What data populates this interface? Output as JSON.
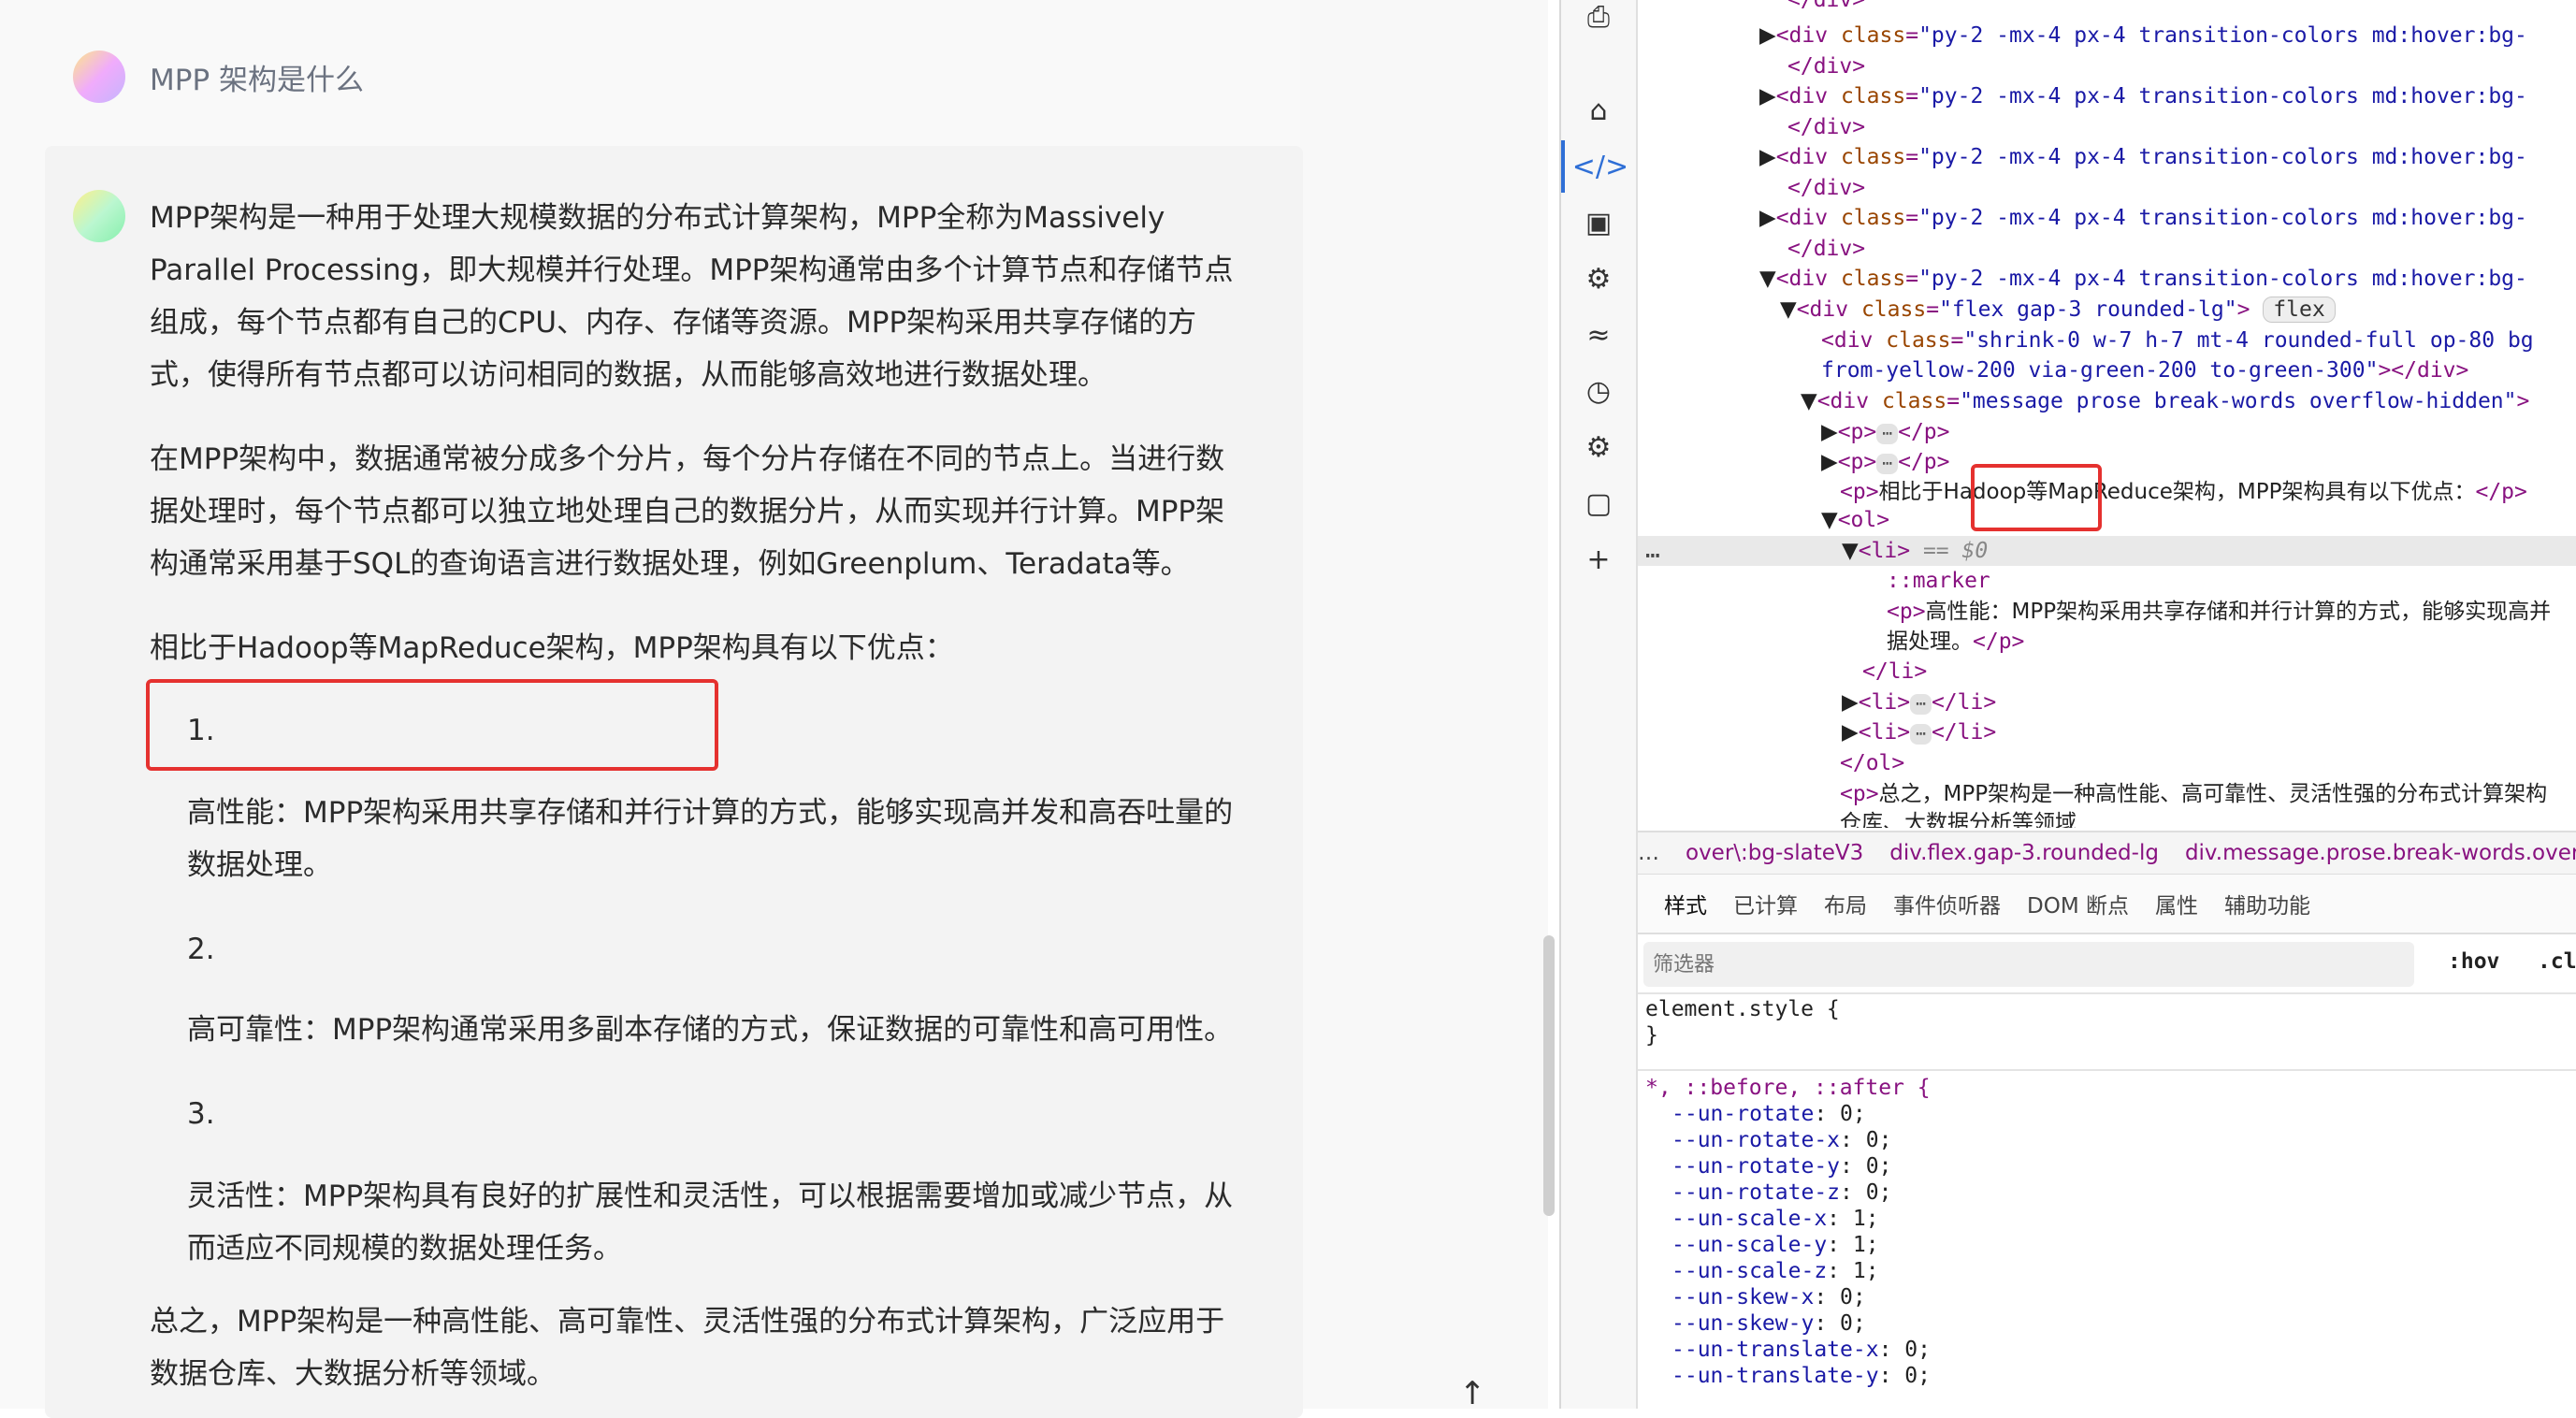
{
  "chat": {
    "user_message": "MPP 架构是什么",
    "answer": {
      "p1_lines": [
        "MPP架构是一种用于处理大规模数据的分布式计算架构，MPP全称为Massively",
        "Parallel Processing，即大规模并行处理。MPP架构通常由多个计算节点和存储节点",
        "组成，每个节点都有自己的CPU、内存、存储等资源。MPP架构采用共享存储的方",
        "式，使得所有节点都可以访问相同的数据，从而能够高效地进行数据处理。"
      ],
      "p2_lines": [
        "在MPP架构中，数据通常被分成多个分片，每个分片存储在不同的节点上。当进行数",
        "据处理时，每个节点都可以独立地处理自己的数据分片，从而实现并行计算。MPP架",
        "构通常采用基于SQL的查询语言进行数据处理，例如Greenplum、Teradata等。"
      ],
      "p3": "相比于Hadoop等MapReduce架构，MPP架构具有以下优点：",
      "list": [
        {
          "num": "1.",
          "lines": [
            "高性能：MPP架构采用共享存储和并行计算的方式，能够实现高并发和高吞吐量的",
            "数据处理。"
          ]
        },
        {
          "num": "2.",
          "lines": [
            "高可靠性：MPP架构通常采用多副本存储的方式，保证数据的可靠性和高可用性。"
          ]
        },
        {
          "num": "3.",
          "lines": [
            "灵活性：MPP架构具有良好的扩展性和灵活性，可以根据需要增加或减少节点，从",
            "而适应不同规模的数据处理任务。"
          ]
        }
      ],
      "end_lines": [
        "总之，MPP架构是一种高性能、高可靠性、灵活性强的分布式计算架构，广泛应用于",
        "数据仓库、大数据分析等领域。"
      ]
    },
    "scroll_top_icon": "↑"
  },
  "devtools": {
    "dom": {
      "close_div": "</div>",
      "div_open": "<div ",
      "class_attr": "class",
      "py_class": "\"py-2 -mx-4 px-4 transition-colors md:hover:bg-",
      "flex_class": "\"flex gap-3 rounded-lg\"",
      "flex_badge": "flex",
      "shrink_class_1": "\"shrink-0 w-7 h-7 mt-4 rounded-full op-80 bg",
      "shrink_class_2": "from-yellow-200 via-green-200 to-green-300\"",
      "message_class": "\"message prose break-words overflow-hidden\"",
      "p_open": "<p>",
      "p_close": "</p>",
      "ell": "⋯",
      "p_text": "相比于Hadoop等MapReduce架构，MPP架构具有以下优点：",
      "ol_open": "<ol>",
      "ol_close": "</ol>",
      "li_open": "<li>",
      "li_close": "</li>",
      "eq0": "== $0",
      "marker": "::marker",
      "li_p_text_1": "高性能：MPP架构采用共享存储和并行计算的方式，能够实现高并",
      "li_p_text_2": "据处理。",
      "end_p_text": "总之，MPP架构是一种高性能、高可靠性、灵活性强的分布式计算架构",
      "end_p_text_2": "仓库、大数据分析等领域",
      "dots": "⋯"
    },
    "breadcrumbs": [
      "…",
      "over\\:bg-slateV3",
      "div.flex.gap-3.rounded-lg",
      "div.message.prose.break-words.overflow"
    ],
    "tabs": [
      "样式",
      "已计算",
      "布局",
      "事件侦听器",
      "DOM 断点",
      "属性",
      "辅助功能"
    ],
    "filter_placeholder": "筛选器",
    "hov": ":hov",
    "cls": ".cls",
    "styles": {
      "element_style": "element.style {",
      "close_brace": "}",
      "universal_selector": "*, ::before, ::after {",
      "props": [
        [
          "--un-rotate",
          "0;"
        ],
        [
          "--un-rotate-x",
          "0;"
        ],
        [
          "--un-rotate-y",
          "0;"
        ],
        [
          "--un-rotate-z",
          "0;"
        ],
        [
          "--un-scale-x",
          "1;"
        ],
        [
          "--un-scale-y",
          "1;"
        ],
        [
          "--un-scale-z",
          "1;"
        ],
        [
          "--un-skew-x",
          "0;"
        ],
        [
          "--un-skew-y",
          "0;"
        ],
        [
          "--un-translate-x",
          "0;"
        ],
        [
          "--un-translate-y",
          "0;"
        ]
      ]
    },
    "sidebar_icons": [
      "device-toggle-icon",
      "home-icon",
      "elements-icon",
      "console-icon",
      "bug-icon",
      "wifi-icon",
      "performance-icon",
      "settings-icon",
      "application-icon",
      "plus-icon"
    ]
  },
  "colors": {
    "highlight_red": "#e5312f",
    "active_blue": "#2f6fd6",
    "tag_purple": "#881280"
  }
}
